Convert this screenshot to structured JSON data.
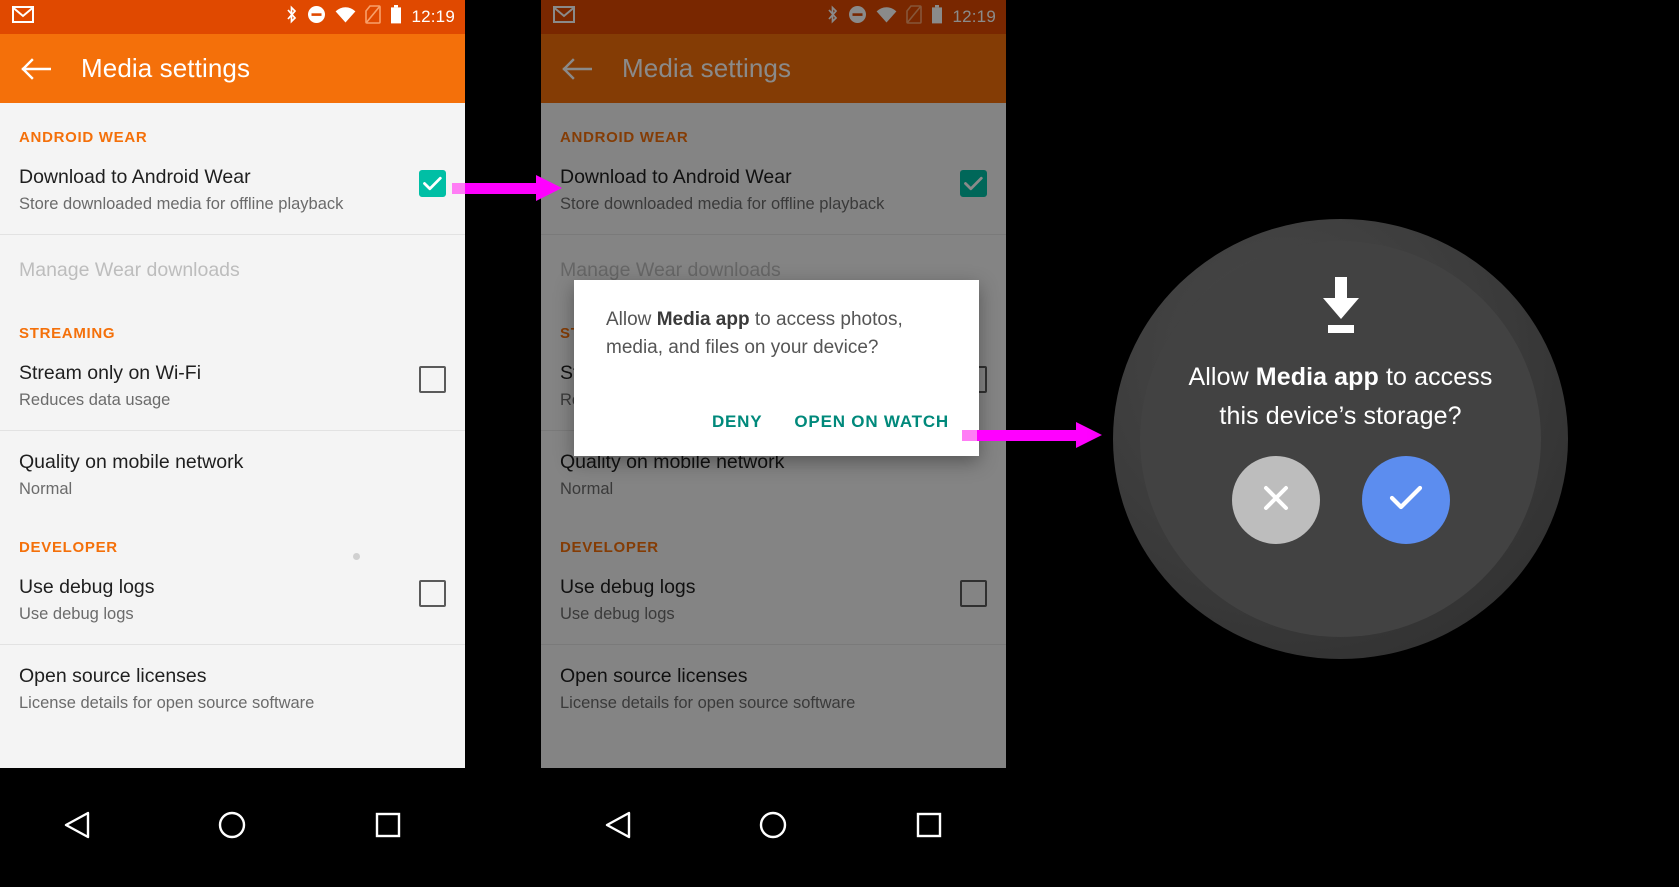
{
  "statusbar": {
    "app_icon": "gmail-icon",
    "icons": [
      "bluetooth-icon",
      "do-not-disturb-icon",
      "wifi-icon",
      "no-sim-icon",
      "battery-icon"
    ],
    "time": "12:19"
  },
  "appbar": {
    "back_icon": "back-arrow-icon",
    "title": "Media settings"
  },
  "settings": {
    "sections": [
      {
        "header": "ANDROID WEAR",
        "rows": [
          {
            "title": "Download to Android Wear",
            "subtitle": "Store downloaded media for offline playback",
            "checkbox": "checked"
          },
          {
            "title": "Manage Wear downloads",
            "subtitle": "",
            "checkbox": "none",
            "disabled": true
          }
        ]
      },
      {
        "header": "STREAMING",
        "rows": [
          {
            "title": "Stream only on Wi-Fi",
            "subtitle": "Reduces data usage",
            "checkbox": "unchecked"
          },
          {
            "title": "Quality on mobile network",
            "subtitle": "Normal",
            "checkbox": "none"
          }
        ]
      },
      {
        "header": "DEVELOPER",
        "rows": [
          {
            "title": "Use debug logs",
            "subtitle": "Use debug logs",
            "checkbox": "unchecked"
          },
          {
            "title": "Open source licenses",
            "subtitle": "License details for open source software",
            "checkbox": "none"
          }
        ]
      }
    ]
  },
  "dialog": {
    "message_prefix": "Allow ",
    "message_bold": "Media app",
    "message_suffix": " to access photos, media, and files on your device?",
    "deny_label": "DENY",
    "open_label": "OPEN ON WATCH"
  },
  "watch": {
    "icon": "download-icon",
    "message_prefix": "Allow ",
    "message_bold": "Media app",
    "message_suffix": " to access this device’s storage?",
    "deny_icon": "close-icon",
    "allow_icon": "check-icon"
  },
  "navbar": {
    "back_icon": "nav-back-triangle-icon",
    "home_icon": "nav-home-circle-icon",
    "recents_icon": "nav-recents-square-icon"
  },
  "arrows": [
    {
      "name": "arrow-phone-to-dialog"
    },
    {
      "name": "arrow-dialog-to-watch"
    }
  ],
  "colors": {
    "status_bar": "#E04900",
    "app_bar": "#F4700A",
    "accent_orange": "#F4700A",
    "checkbox_checked": "#00BFA5",
    "dialog_action": "#00897B",
    "arrow": "#FF00FF",
    "watch_allow": "#5C8DEF",
    "watch_deny": "#BDBDBD",
    "background": "#F4F4F4"
  }
}
